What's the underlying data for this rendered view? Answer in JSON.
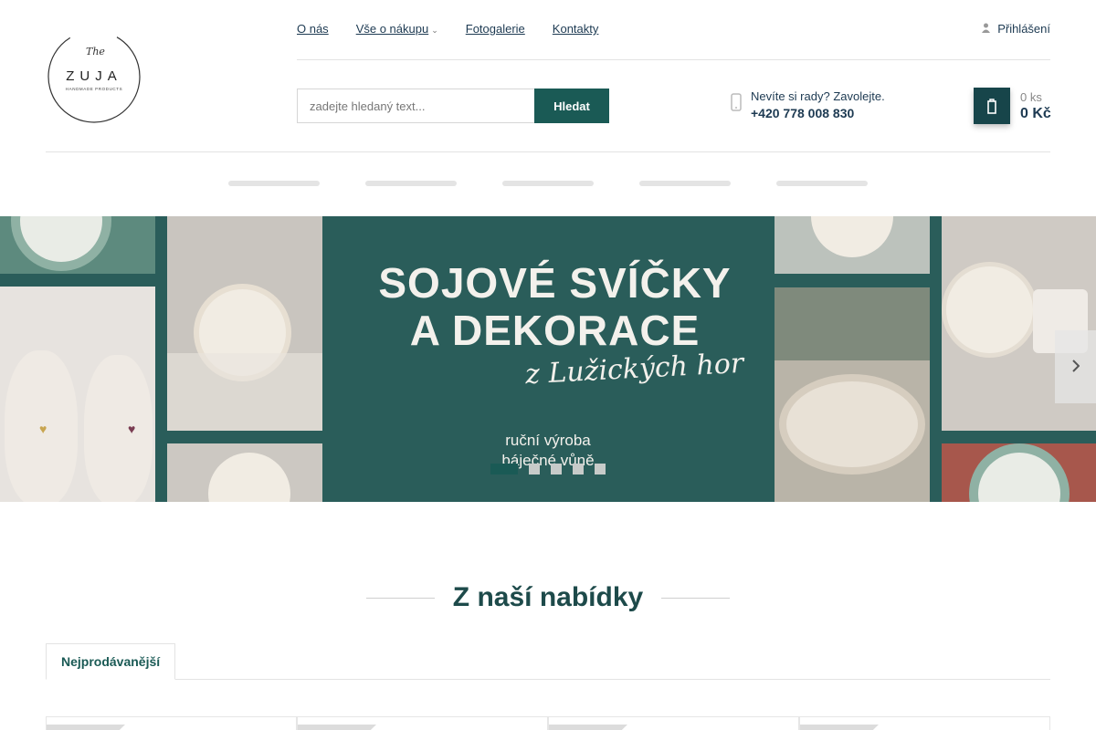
{
  "header": {
    "logo": {
      "line1": "The",
      "line2": "ZUJA",
      "line3": "HANDMADE PRODUCTS"
    },
    "nav": [
      {
        "label": "O nás"
      },
      {
        "label": "Vše o nákupu",
        "has_dropdown": true
      },
      {
        "label": "Fotogalerie"
      },
      {
        "label": "Kontakty"
      }
    ],
    "login_label": "Přihlášení",
    "login_icon": "user-icon",
    "search": {
      "placeholder": "zadejte hledaný text...",
      "button": "Hledat"
    },
    "phone": {
      "icon": "phone-icon",
      "text": "Nevíte si rady? Zavolejte.",
      "number": "+420 778 008 830"
    },
    "cart": {
      "icon": "cart-icon",
      "quantity": "0 ks",
      "price": "0 Kč"
    },
    "category_count": 5
  },
  "banner": {
    "headline_line1": "SOJOVÉ SVÍČKY",
    "headline_line2": "A DEKORACE",
    "script": "z Lužických hor",
    "sub1": "ruční výroba",
    "sub2": "báječné vůně",
    "slides": 5,
    "active_slide": 1,
    "next_icon": "chevron-right-icon"
  },
  "offer": {
    "title": "Z naší nabídky",
    "tab": "Nejprodávanější"
  },
  "colors": {
    "accent": "#1a5a55",
    "banner_bg": "#2a5d5a",
    "text_dark": "#1d3a52"
  }
}
